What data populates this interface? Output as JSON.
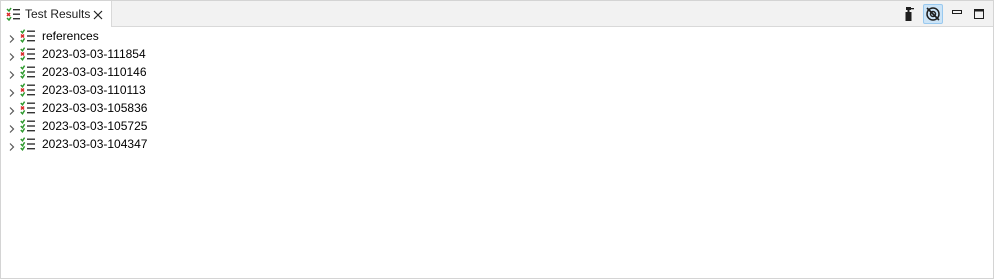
{
  "tab": {
    "title": "Test Results",
    "icon": "test-results-icon",
    "close_icon": "close-icon"
  },
  "toolbar": {
    "buttons": [
      {
        "icon": "spray-clean-icon",
        "active": false
      },
      {
        "icon": "disable-filter-icon",
        "active": true
      },
      {
        "icon": "minimize-icon",
        "active": false
      },
      {
        "icon": "maximize-icon",
        "active": false
      }
    ]
  },
  "colors": {
    "pass": "#2e9a2e",
    "fail": "#d92626",
    "active_bg": "#cce4f7"
  },
  "tree": {
    "items": [
      {
        "label": "references",
        "status": "fail",
        "expanded": false
      },
      {
        "label": "2023-03-03-111854",
        "status": "fail",
        "expanded": false
      },
      {
        "label": "2023-03-03-110146",
        "status": "pass",
        "expanded": false
      },
      {
        "label": "2023-03-03-110113",
        "status": "fail",
        "expanded": false
      },
      {
        "label": "2023-03-03-105836",
        "status": "fail",
        "expanded": false
      },
      {
        "label": "2023-03-03-105725",
        "status": "pass",
        "expanded": false
      },
      {
        "label": "2023-03-03-104347",
        "status": "pass",
        "expanded": false
      }
    ]
  }
}
